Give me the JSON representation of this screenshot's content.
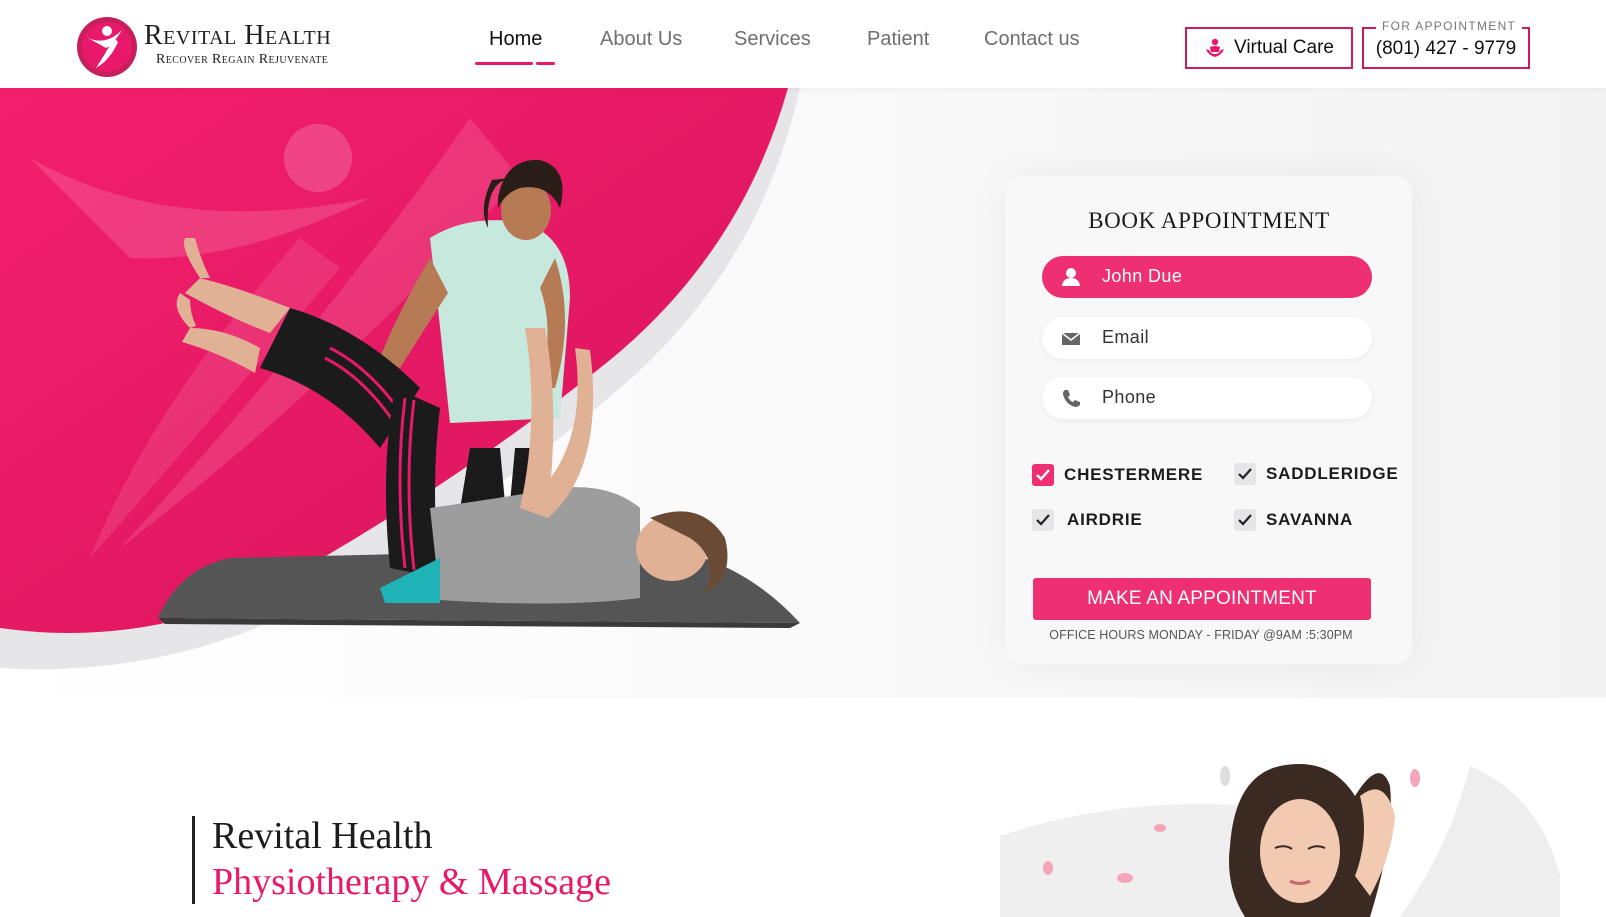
{
  "brand": {
    "name": "Revital Health",
    "tagline": "Recover Regain Rejuvenate"
  },
  "nav": {
    "items": [
      {
        "label": "Home",
        "active": true
      },
      {
        "label": "About Us",
        "active": false
      },
      {
        "label": "Services",
        "active": false
      },
      {
        "label": "Patient",
        "active": false
      },
      {
        "label": "Contact us",
        "active": false
      }
    ]
  },
  "header_actions": {
    "virtual_care_label": "Virtual Care",
    "appointment_caption": "FOR APPOINTMENT",
    "appointment_phone": "(801) 427 - 9779"
  },
  "booking": {
    "title": "BOOK APPOINTMENT",
    "name_field": {
      "value": "John Due",
      "icon": "user-icon"
    },
    "email_field": {
      "placeholder": "Email",
      "icon": "envelope-icon"
    },
    "phone_field": {
      "placeholder": "Phone",
      "icon": "phone-icon"
    },
    "locations": [
      {
        "label": "CHESTERMERE",
        "checked": true
      },
      {
        "label": "SADDLERIDGE",
        "checked": false
      },
      {
        "label": "AIRDRIE",
        "checked": false
      },
      {
        "label": "SAVANNA",
        "checked": false
      }
    ],
    "submit_label": "MAKE AN APPOINTMENT",
    "office_hours": "OFFICE HOURS MONDAY - FRIDAY @9AM :5:30PM"
  },
  "intro": {
    "line1": "Revital Health",
    "line2": "Physiotherapy & Massage"
  },
  "colors": {
    "accent": "#ee2f72",
    "accent_dark": "#c71e5c",
    "text": "#1c1c1c"
  }
}
